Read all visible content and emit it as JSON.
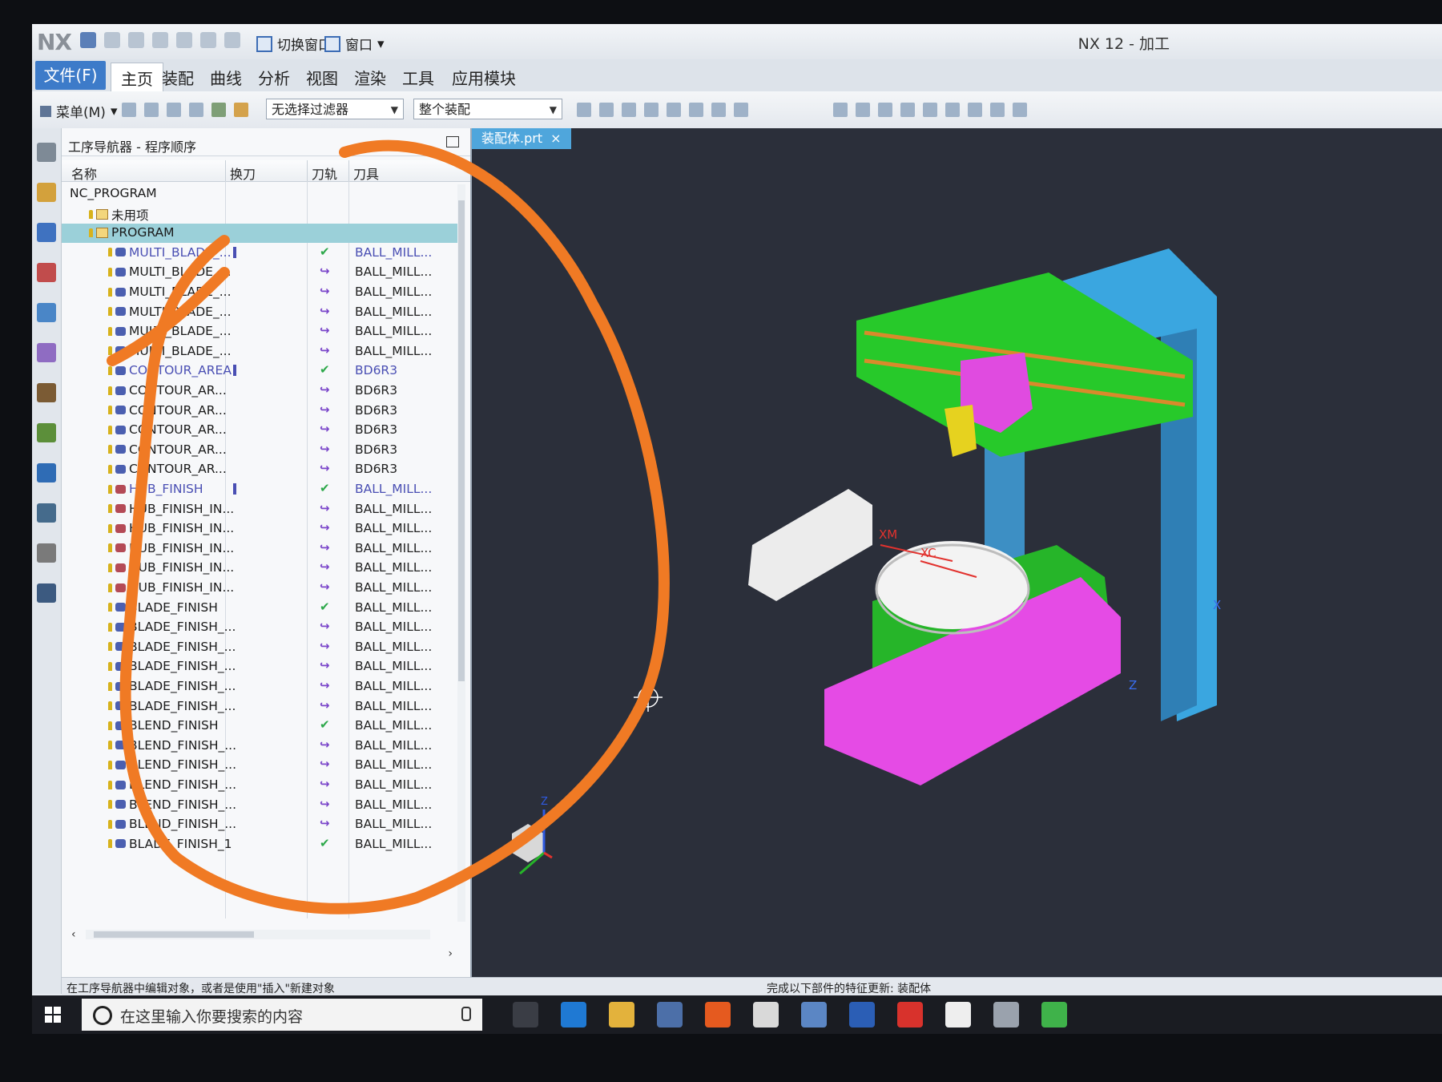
{
  "app": {
    "logo": "NX",
    "window_title": "NX 12 - 加工",
    "quick_access": {
      "switch_window": "切换窗口",
      "window": "窗口"
    }
  },
  "ribbon": {
    "tabs": [
      "文件(F)",
      "主页",
      "装配",
      "曲线",
      "分析",
      "视图",
      "渲染",
      "工具",
      "应用模块"
    ],
    "active_tab": "主页"
  },
  "toolbar": {
    "menu_label": "菜单(M)",
    "filter_value": "无选择过滤器",
    "assembly_scope": "整个装配"
  },
  "navigator": {
    "title": "工序导航器 - 程序顺序",
    "columns": {
      "name": "名称",
      "toolchange": "换刀",
      "path": "刀轨",
      "tool": "刀具"
    },
    "rows": [
      {
        "name": "NC_PROGRAM",
        "indent": 0,
        "icon": "none",
        "mark": "",
        "tool": ""
      },
      {
        "name": "未用项",
        "indent": 1,
        "icon": "group",
        "mark": "",
        "tool": ""
      },
      {
        "name": "PROGRAM",
        "indent": 1,
        "icon": "group",
        "mark": "",
        "tool": "",
        "selected": true
      },
      {
        "name": "MULTI_BLADE_...",
        "indent": 2,
        "icon": "op",
        "mark": "check",
        "tool": "BALL_MILL...",
        "highlight": true
      },
      {
        "name": "MULTI_BLADE_...",
        "indent": 2,
        "icon": "op",
        "mark": "arrow",
        "tool": "BALL_MILL..."
      },
      {
        "name": "MULTI_BLADE_...",
        "indent": 2,
        "icon": "op",
        "mark": "arrow",
        "tool": "BALL_MILL..."
      },
      {
        "name": "MULTI_BLADE_...",
        "indent": 2,
        "icon": "op",
        "mark": "arrow",
        "tool": "BALL_MILL..."
      },
      {
        "name": "MULTI_BLADE_...",
        "indent": 2,
        "icon": "op",
        "mark": "arrow",
        "tool": "BALL_MILL..."
      },
      {
        "name": "MULTI_BLADE_...",
        "indent": 2,
        "icon": "op",
        "mark": "arrow",
        "tool": "BALL_MILL..."
      },
      {
        "name": "CONTOUR_AREA",
        "indent": 2,
        "icon": "op",
        "mark": "check",
        "tool": "BD6R3",
        "highlight": true
      },
      {
        "name": "CONTOUR_AR...",
        "indent": 2,
        "icon": "op",
        "mark": "arrow",
        "tool": "BD6R3"
      },
      {
        "name": "CONTOUR_AR...",
        "indent": 2,
        "icon": "op",
        "mark": "arrow",
        "tool": "BD6R3"
      },
      {
        "name": "CONTOUR_AR...",
        "indent": 2,
        "icon": "op",
        "mark": "arrow",
        "tool": "BD6R3"
      },
      {
        "name": "CONTOUR_AR...",
        "indent": 2,
        "icon": "op",
        "mark": "arrow",
        "tool": "BD6R3"
      },
      {
        "name": "CONTOUR_AR...",
        "indent": 2,
        "icon": "op",
        "mark": "arrow",
        "tool": "BD6R3"
      },
      {
        "name": "HUB_FINISH",
        "indent": 2,
        "icon": "op-red",
        "mark": "check",
        "tool": "BALL_MILL...",
        "highlight": true
      },
      {
        "name": "HUB_FINISH_IN...",
        "indent": 2,
        "icon": "op-red",
        "mark": "arrow",
        "tool": "BALL_MILL..."
      },
      {
        "name": "HUB_FINISH_IN...",
        "indent": 2,
        "icon": "op-red",
        "mark": "arrow",
        "tool": "BALL_MILL..."
      },
      {
        "name": "HUB_FINISH_IN...",
        "indent": 2,
        "icon": "op-red",
        "mark": "arrow",
        "tool": "BALL_MILL..."
      },
      {
        "name": "HUB_FINISH_IN...",
        "indent": 2,
        "icon": "op-red",
        "mark": "arrow",
        "tool": "BALL_MILL..."
      },
      {
        "name": "HUB_FINISH_IN...",
        "indent": 2,
        "icon": "op-red",
        "mark": "arrow",
        "tool": "BALL_MILL..."
      },
      {
        "name": "BLADE_FINISH",
        "indent": 2,
        "icon": "op",
        "mark": "check",
        "tool": "BALL_MILL..."
      },
      {
        "name": "BLADE_FINISH_...",
        "indent": 2,
        "icon": "op",
        "mark": "arrow",
        "tool": "BALL_MILL..."
      },
      {
        "name": "BLADE_FINISH_...",
        "indent": 2,
        "icon": "op",
        "mark": "arrow",
        "tool": "BALL_MILL..."
      },
      {
        "name": "BLADE_FINISH_...",
        "indent": 2,
        "icon": "op",
        "mark": "arrow",
        "tool": "BALL_MILL..."
      },
      {
        "name": "BLADE_FINISH_...",
        "indent": 2,
        "icon": "op",
        "mark": "arrow",
        "tool": "BALL_MILL..."
      },
      {
        "name": "BLADE_FINISH_...",
        "indent": 2,
        "icon": "op",
        "mark": "arrow",
        "tool": "BALL_MILL..."
      },
      {
        "name": "BLEND_FINISH",
        "indent": 2,
        "icon": "op",
        "mark": "check",
        "tool": "BALL_MILL..."
      },
      {
        "name": "BLEND_FINISH_...",
        "indent": 2,
        "icon": "op",
        "mark": "arrow",
        "tool": "BALL_MILL..."
      },
      {
        "name": "BLEND_FINISH_...",
        "indent": 2,
        "icon": "op",
        "mark": "arrow",
        "tool": "BALL_MILL..."
      },
      {
        "name": "BLEND_FINISH_...",
        "indent": 2,
        "icon": "op",
        "mark": "arrow",
        "tool": "BALL_MILL..."
      },
      {
        "name": "BLEND_FINISH_...",
        "indent": 2,
        "icon": "op",
        "mark": "arrow",
        "tool": "BALL_MILL..."
      },
      {
        "name": "BLEND_FINISH_...",
        "indent": 2,
        "icon": "op",
        "mark": "arrow",
        "tool": "BALL_MILL..."
      },
      {
        "name": "BLADE_FINISH_1",
        "indent": 2,
        "icon": "op",
        "mark": "check",
        "tool": "BALL_MILL..."
      }
    ]
  },
  "graphics": {
    "doc_tab": "装配体.prt",
    "axis_labels": {
      "xm": "XM",
      "xc": "XC",
      "x": "X",
      "z": "Z",
      "triad_z": "Z"
    }
  },
  "status": {
    "left": "在工序导航器中编辑对象，或者是使用\"插入\"新建对象",
    "right": "完成以下部件的特征更新: 装配体"
  },
  "taskbar": {
    "search_placeholder": "在这里输入你要搜索的内容"
  },
  "colors": {
    "accent": "#3d7bc9",
    "annotation": "#f07a24",
    "viewport": "#2b2f3a"
  }
}
